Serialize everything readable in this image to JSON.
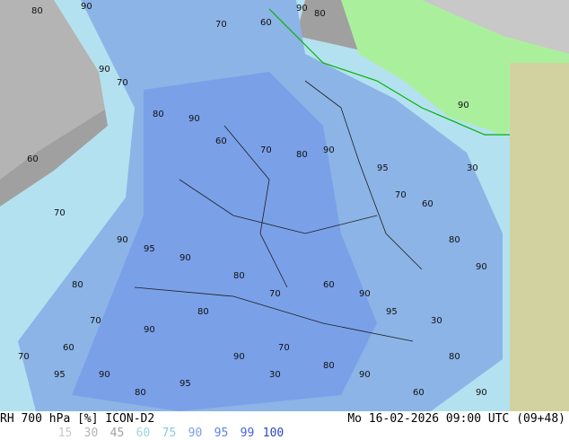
{
  "title": "RH 700 hPa [%] ICON-D2",
  "datetime": "Mo 16-02-2026 09:00 UTC (09+48)",
  "legend": [
    {
      "value": "15",
      "color": "#c8c8c8"
    },
    {
      "value": "30",
      "color": "#b4b4b4"
    },
    {
      "value": "45",
      "color": "#a0a0a0"
    },
    {
      "value": "60",
      "color": "#a0d2e6"
    },
    {
      "value": "75",
      "color": "#8cc8e6"
    },
    {
      "value": "90",
      "color": "#78a0e6"
    },
    {
      "value": "95",
      "color": "#5a82e6"
    },
    {
      "value": "99",
      "color": "#4664dc"
    },
    {
      "value": "100",
      "color": "#2846c8"
    }
  ],
  "map_colors": {
    "dry": "#a0a0a0",
    "dry_light": "#bebebe",
    "moist": "#b4e1f0",
    "wet": "#8cb4e6",
    "very_wet": "#6e96e6",
    "outside_land": "#aaf09c",
    "outside_gray": "#c8c8c8",
    "outside_tan": "#d2d2a0",
    "borders": "#1e1e1e",
    "coast": "#00b400"
  },
  "contour_labels": [
    "80",
    "90",
    "70",
    "60",
    "90",
    "80",
    "90",
    "70",
    "80",
    "90",
    "60",
    "70",
    "80",
    "90",
    "95",
    "70",
    "60",
    "80",
    "90",
    "30",
    "60",
    "70",
    "80",
    "90",
    "95",
    "90",
    "80",
    "70",
    "60",
    "90",
    "95",
    "30",
    "80",
    "90",
    "70",
    "60",
    "90",
    "80",
    "95",
    "90",
    "70",
    "80",
    "90",
    "60",
    "30",
    "80",
    "90",
    "70",
    "95",
    "90"
  ]
}
